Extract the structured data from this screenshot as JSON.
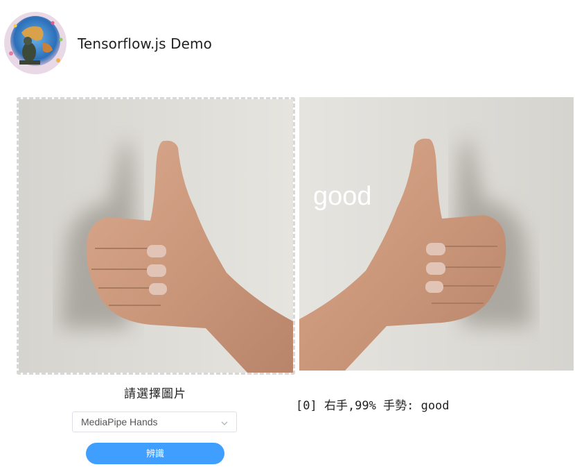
{
  "header": {
    "title": "Tensorflow.js Demo",
    "avatar_icon": "thinker-globe-avatar"
  },
  "upload": {
    "image_icon": "thumbs-up-hand-photo"
  },
  "result": {
    "image_icon": "mirrored-thumbs-up-hand-photo",
    "overlay_label": "good",
    "text": "[0] 右手,99% 手勢: good"
  },
  "controls": {
    "select_label": "請選擇圖片",
    "model_select_value": "MediaPipe Hands",
    "recognize_label": "辨識"
  },
  "colors": {
    "accent": "#409eff",
    "background_wall": "#dcd9d4"
  }
}
